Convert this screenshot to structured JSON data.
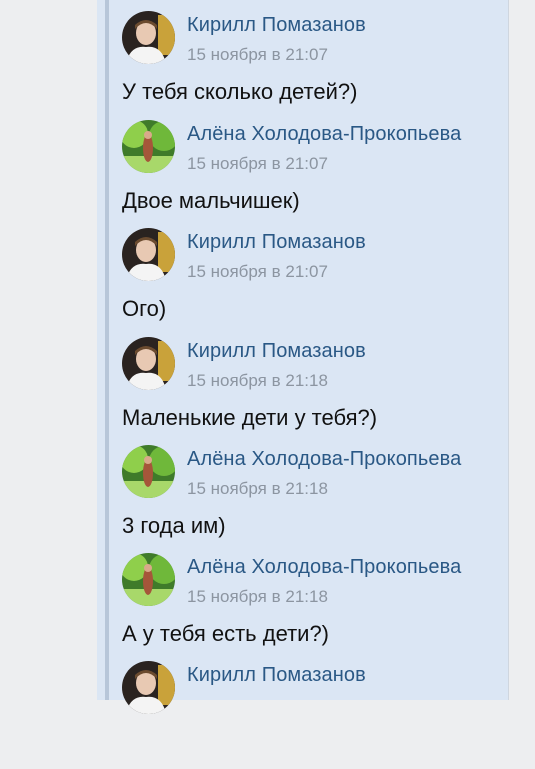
{
  "messages": [
    {
      "avatar": "male",
      "name": "Кирилл Помазанов",
      "time": "15 ноября в 21:07",
      "text": "У тебя сколько детей?)"
    },
    {
      "avatar": "female",
      "name": "Алёна Холодова-Прокопьева",
      "time": "15 ноября в 21:07",
      "text": "Двое мальчишек)"
    },
    {
      "avatar": "male",
      "name": "Кирилл Помазанов",
      "time": "15 ноября в 21:07",
      "text": "Ого)"
    },
    {
      "avatar": "male",
      "name": "Кирилл Помазанов",
      "time": "15 ноября в 21:18",
      "text": "Маленькие дети у тебя?)"
    },
    {
      "avatar": "female",
      "name": "Алёна Холодова-Прокопьева",
      "time": "15 ноября в 21:18",
      "text": "3 года им)"
    },
    {
      "avatar": "female",
      "name": "Алёна Холодова-Прокопьева",
      "time": "15 ноября в 21:18",
      "text": "А у тебя есть дети?)"
    },
    {
      "avatar": "male",
      "name": "Кирилл Помазанов",
      "time": "",
      "text": ""
    }
  ],
  "colors": {
    "name": "#2a5885",
    "time": "#8c95a1",
    "panel": "#dbe6f4",
    "quote_line": "#b7c6d9"
  }
}
